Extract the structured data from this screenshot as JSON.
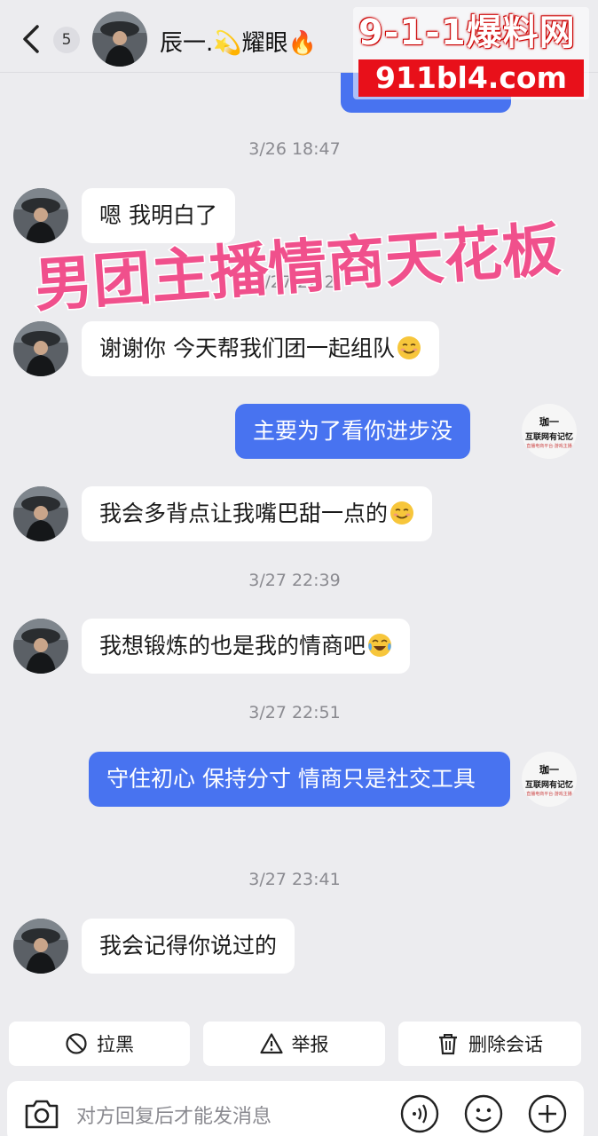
{
  "header": {
    "unread_count": "5",
    "contact_name": "辰一.💫耀眼🔥"
  },
  "watermark": {
    "top_text": "9-1-1爆料网",
    "bottom_text": "911bl4.com"
  },
  "overlay_caption": "男团主播情商天花板",
  "messages": [
    {
      "type": "timestamp",
      "text": "3/26 18:47"
    },
    {
      "type": "in",
      "text": "嗯 我明白了"
    },
    {
      "type": "timestamp",
      "text": "3/27 22:2"
    },
    {
      "type": "in",
      "text": "谢谢你 今天帮我们团一起组队",
      "emoji": "smiling-face-emoji"
    },
    {
      "type": "out",
      "text": "主要为了看你进步没"
    },
    {
      "type": "in",
      "text": "我会多背点让我嘴巴甜一点的",
      "emoji": "smiling-face-emoji"
    },
    {
      "type": "timestamp",
      "text": "3/27 22:39"
    },
    {
      "type": "in",
      "text": "我想锻炼的也是我的情商吧",
      "emoji": "crying-laughing-emoji"
    },
    {
      "type": "timestamp",
      "text": "3/27 22:51"
    },
    {
      "type": "out",
      "text": "守住初心 保持分寸 情商只是社交工具"
    },
    {
      "type": "timestamp",
      "text": "3/27 23:41"
    },
    {
      "type": "in",
      "text": "我会记得你说过的"
    }
  ],
  "my_avatar": {
    "line1": "珈一",
    "line2": "互联网有记忆",
    "line3": "直播电商平台·游戏主播"
  },
  "actions": {
    "block": "拉黑",
    "report": "举报",
    "delete": "删除会话"
  },
  "input": {
    "placeholder": "对方回复后才能发消息"
  },
  "colors": {
    "outgoing_bubble": "#4873f0",
    "incoming_bubble": "#ffffff",
    "background": "#ececef",
    "overlay_text": "#f0508c"
  },
  "icons": [
    "back-arrow-icon",
    "camera-icon",
    "voice-icon",
    "emoji-icon",
    "plus-icon",
    "block-icon",
    "warning-icon",
    "trash-icon"
  ]
}
